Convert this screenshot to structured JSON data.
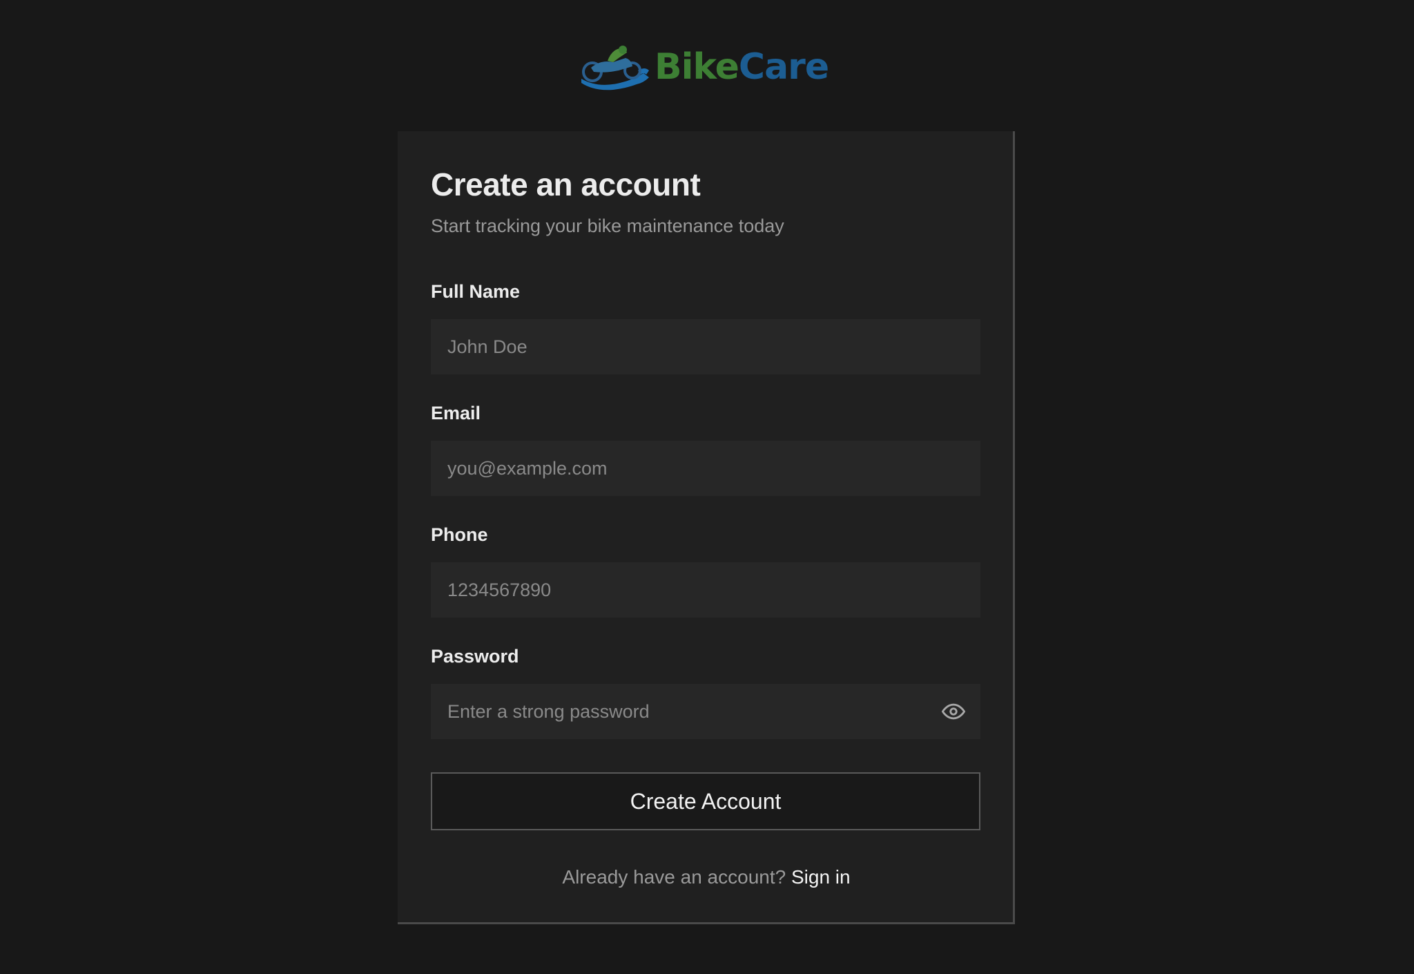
{
  "brand": {
    "name_part1": "Bike",
    "name_part2": "Care",
    "logo_icon": "motorcycle-wrench-icon",
    "color_green": "#3d7f34",
    "color_blue": "#1c5d92"
  },
  "form": {
    "title": "Create an account",
    "subtitle": "Start tracking your bike maintenance today",
    "fields": {
      "full_name": {
        "label": "Full Name",
        "placeholder": "John Doe",
        "value": ""
      },
      "email": {
        "label": "Email",
        "placeholder": "you@example.com",
        "value": ""
      },
      "phone": {
        "label": "Phone",
        "placeholder": "1234567890",
        "value": ""
      },
      "password": {
        "label": "Password",
        "placeholder": "Enter a strong password",
        "value": "",
        "toggle_icon": "eye-icon"
      }
    },
    "submit_label": "Create Account",
    "footer_text": "Already have an account?",
    "signin_label": "Sign in"
  },
  "colors": {
    "background": "#181818",
    "card": "#202020",
    "input": "#272727"
  }
}
